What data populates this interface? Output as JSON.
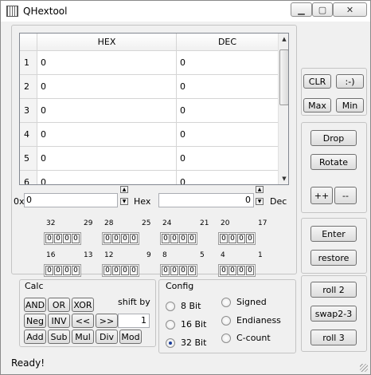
{
  "window": {
    "title": "QHextool",
    "min_glyph": "▁",
    "max_glyph": "▢",
    "close_glyph": "✕"
  },
  "table": {
    "headers": [
      "HEX",
      "DEC"
    ],
    "rows": [
      {
        "num": "1",
        "hex": "0",
        "dec": "0"
      },
      {
        "num": "2",
        "hex": "0",
        "dec": "0"
      },
      {
        "num": "3",
        "hex": "0",
        "dec": "0"
      },
      {
        "num": "4",
        "hex": "0",
        "dec": "0"
      },
      {
        "num": "5",
        "hex": "0",
        "dec": "0"
      },
      {
        "num": "6",
        "hex": "0",
        "dec": "0"
      }
    ]
  },
  "inputs": {
    "hex_prefix": "0x",
    "hex_value": "0",
    "hex_label": "Hex",
    "dec_value": "0",
    "dec_label": "Dec"
  },
  "bits": {
    "row1_labels": [
      "32",
      "29",
      "28",
      "25",
      "24",
      "21",
      "20",
      "17"
    ],
    "row2_labels": [
      "16",
      "13",
      "12",
      "9",
      "8",
      "5",
      "4",
      "1"
    ],
    "bit_value": "0"
  },
  "calc": {
    "title": "Calc",
    "buttons": [
      "AND",
      "OR",
      "XOR",
      "Neg",
      "INV",
      "<<",
      ">>",
      "Add",
      "Sub",
      "Mul",
      "Div",
      "Mod"
    ],
    "shift_label": "shift by",
    "shift_value": "1"
  },
  "config": {
    "title": "Config",
    "options": [
      {
        "label": "8 Bit",
        "checked": false
      },
      {
        "label": "16 Bit",
        "checked": false
      },
      {
        "label": "32 Bit",
        "checked": true
      },
      {
        "label": "Signed",
        "checked": false
      },
      {
        "label": "Endianess",
        "checked": false
      },
      {
        "label": "C-count",
        "checked": false
      }
    ]
  },
  "side": {
    "clr": "CLR",
    "smile": ":-)",
    "max": "Max",
    "min": "Min",
    "drop": "Drop",
    "rotate": "Rotate",
    "plusplus": "++",
    "minusminus": "--",
    "enter": "Enter",
    "restore": "restore",
    "roll2": "roll 2",
    "swap": "swap2-3",
    "roll3": "roll 3"
  },
  "status": "Ready!"
}
